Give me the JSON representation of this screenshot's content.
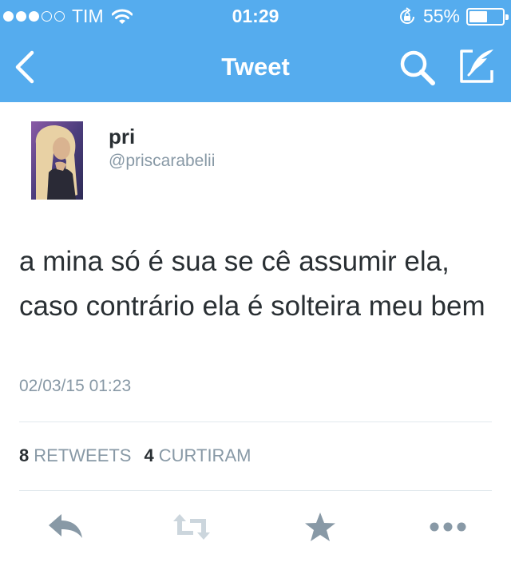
{
  "status_bar": {
    "carrier": "TIM",
    "signal_bars_filled": 3,
    "signal_bars_total": 5,
    "time": "01:29",
    "battery_percent": "55%",
    "battery_level": 0.55
  },
  "nav": {
    "title": "Tweet",
    "icons": [
      "back-chevron-icon",
      "search-icon",
      "compose-icon"
    ]
  },
  "tweet": {
    "author_name": "pri",
    "author_handle": "@priscarabelii",
    "text": "a mina só é sua se cê assumir ela, caso contrário ela é solteira meu bem",
    "timestamp": "02/03/15 01:23"
  },
  "stats": {
    "retweets_count": "8",
    "retweets_label": "RETWEETS",
    "likes_count": "4",
    "likes_label": "CURTIRAM"
  },
  "actions": [
    "reply-icon",
    "retweet-icon",
    "favorite-icon",
    "more-icon"
  ],
  "colors": {
    "header_bg": "#55acee",
    "text_primary": "#292f33",
    "text_secondary": "#8899a6",
    "icon_gray": "#8899a6",
    "icon_light": "#ccd6dd",
    "divider": "#e1e8ed"
  }
}
